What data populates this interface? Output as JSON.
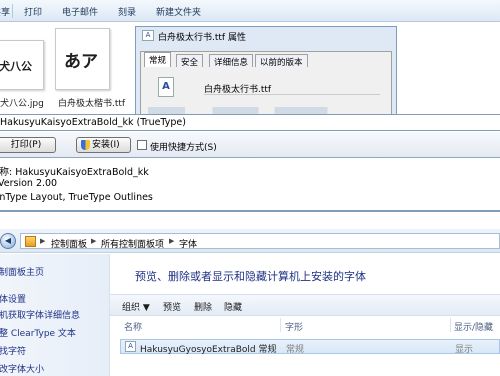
{
  "explorer_toolbar": {
    "items": [
      "共享",
      "打印",
      "电子邮件",
      "刻录",
      "新建文件夹"
    ]
  },
  "thumbnails": [
    {
      "image_text": "犬八公",
      "caption": "犬八公.jpg"
    },
    {
      "image_text": "あア",
      "caption": "白舟极太楷书.ttf"
    }
  ],
  "properties_dialog": {
    "title": "白舟极太行书.ttf 属性",
    "tabs": [
      "常规",
      "安全",
      "详细信息",
      "以前的版本"
    ],
    "active_tab": "常规",
    "filename_value": "白舟极太行书.ttf",
    "file_icon_glyph": "A"
  },
  "font_viewer": {
    "title": "HakusyuKaisyoExtraBold_kk (TrueType)",
    "print_button": "打印(P)",
    "install_button": "安装(I)",
    "shortcut_checkbox_label": "使用快捷方式(S)",
    "shortcut_checked": false,
    "info_lines": [
      "名称: HakusyuKaisyoExtraBold_kk",
      "Version 2.00",
      "OpenType Layout, TrueType Outlines"
    ]
  },
  "control_panel": {
    "breadcrumb": [
      "控制面板",
      "所有控制面板项",
      "字体"
    ],
    "sidebar_links": [
      "控制面板主页",
      "字体设置",
      "联机获取字体详细信息",
      "调整 ClearType 文本",
      "查找字符",
      "更改字体大小"
    ],
    "main_title": "预览、删除或者显示和隐藏计算机上安装的字体",
    "command_bar": {
      "organize": "组织 ▼",
      "preview": "预览",
      "delete": "删除",
      "hide": "隐藏"
    },
    "columns": [
      "名称",
      "字形",
      "显示/隐藏"
    ],
    "rows": [
      {
        "name": "HakusyuGyosyoExtraBold 常规",
        "style": "常规",
        "visibility": "显示"
      }
    ]
  }
}
